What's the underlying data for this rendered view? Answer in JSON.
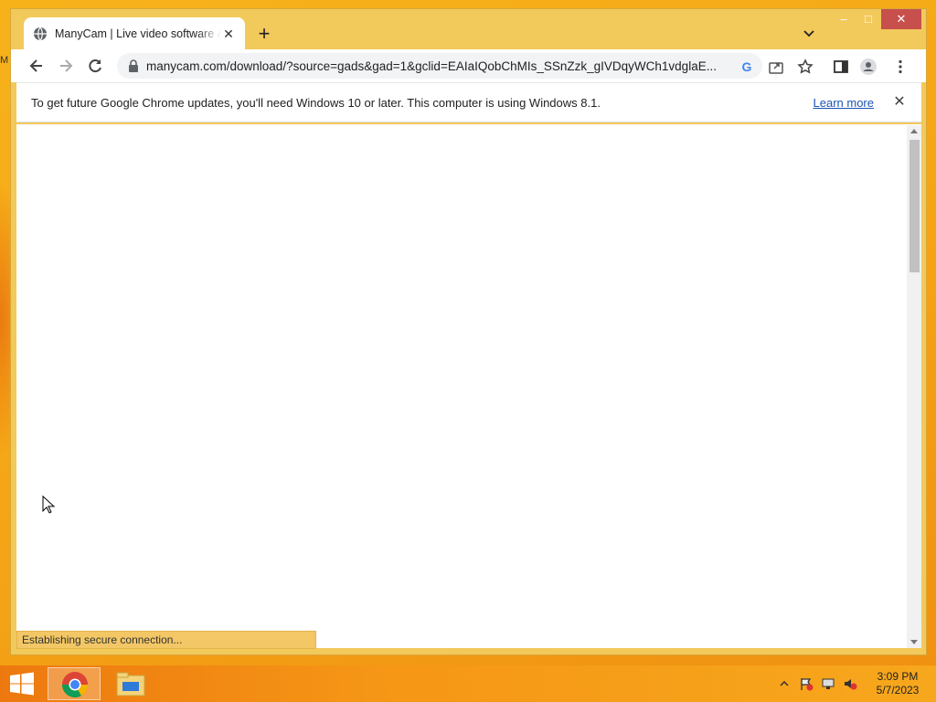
{
  "desktop": {
    "edge_letter": "M",
    "background_color": "#f4a416"
  },
  "browser": {
    "tab": {
      "title": "ManyCam | Live video software & webcam",
      "favicon": "globe-icon"
    },
    "new_tab_icon": "plus-icon",
    "tab_search_icon": "chevron-down-icon",
    "window_controls": {
      "minimize": "–",
      "maximize": "□",
      "close": "✕"
    },
    "toolbar": {
      "back_icon": "arrow-left-icon",
      "forward_icon": "arrow-right-icon",
      "reload_icon": "reload-icon",
      "url": "manycam.com/download/?source=gads&gad=1&gclid=EAIaIQobChMIs_SSnZzk_gIVDqyWCh1vdglaE...",
      "lock_icon": "lock-icon",
      "google_icon": "G",
      "share_icon": "share-icon",
      "bookmark_icon": "star-icon",
      "side_panel_icon": "side-panel-icon",
      "profile_icon": "profile-icon",
      "menu_icon": "kebab-menu-icon"
    },
    "infobar": {
      "message": "To get future Google Chrome updates, you'll need Windows 10 or later. This computer is using Windows 8.1.",
      "link": "Learn more",
      "close": "✕"
    },
    "status": "Establishing secure connection...",
    "accent_color": "#f2c95b"
  },
  "taskbar": {
    "start_icon": "windows-logo-icon",
    "items": [
      "chrome-icon",
      "file-explorer-icon"
    ],
    "tray": [
      "show-hidden-icons-icon",
      "action-center-flag-icon",
      "network-icon",
      "volume-muted-icon"
    ],
    "clock": {
      "time": "3:09 PM",
      "date": "5/7/2023"
    }
  }
}
